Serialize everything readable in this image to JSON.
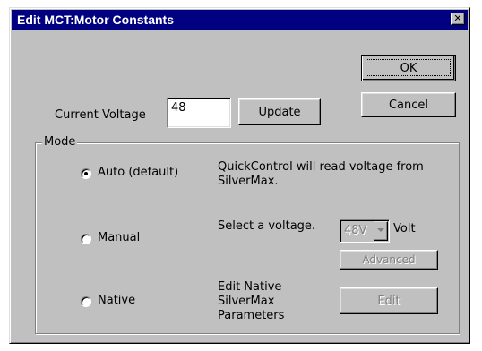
{
  "window": {
    "title": "Edit MCT:Motor Constants",
    "close_glyph": "✕"
  },
  "buttons": {
    "ok": "OK",
    "cancel": "Cancel",
    "update": "Update",
    "advanced": "Advanced",
    "edit": "Edit"
  },
  "current_voltage": {
    "label": "Current Voltage",
    "value": "48"
  },
  "mode": {
    "group_label": "Mode",
    "options": [
      {
        "label": "Auto (default)",
        "description": "QuickControl will read voltage from SilverMax.",
        "selected": true
      },
      {
        "label": "Manual",
        "description": "Select a voltage.",
        "selected": false
      },
      {
        "label": "Native",
        "description": "Edit Native SilverMax Parameters",
        "selected": false
      }
    ]
  },
  "voltage_select": {
    "value": "48V",
    "unit_label": "Volt"
  },
  "icons": {
    "close": "close-icon",
    "dropdown": "chevron-down-icon"
  }
}
